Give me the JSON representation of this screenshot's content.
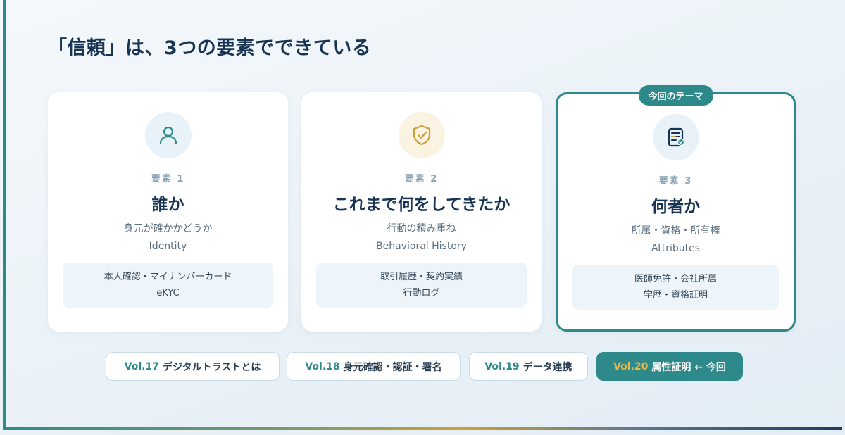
{
  "heading": "「信頼」は、3つの要素でできている",
  "cards": [
    {
      "icon": "person-icon",
      "element_no": "要素 1",
      "title": "誰か",
      "desc_ja": "身元が確かかどうか",
      "desc_en": "Identity",
      "example_line1": "本人確認・マイナンバーカード",
      "example_line2": "eKYC"
    },
    {
      "icon": "shield-check-icon",
      "element_no": "要素 2",
      "title": "これまで何をしてきたか",
      "desc_ja": "行動の積み重ね",
      "desc_en": "Behavioral History",
      "example_line1": "取引履歴・契約実績",
      "example_line2": "行動ログ"
    },
    {
      "icon": "certificate-icon",
      "badge": "今回のテーマ",
      "element_no": "要素 3",
      "title": "何者か",
      "desc_ja": "所属・資格・所有権",
      "desc_en": "Attributes",
      "example_line1": "医師免許・会社所属",
      "example_line2": "学歴・資格証明"
    }
  ],
  "nav": [
    {
      "vol": "Vol.17",
      "label": "デジタルトラストとは"
    },
    {
      "vol": "Vol.18",
      "label": "身元確認・認証・署名"
    },
    {
      "vol": "Vol.19",
      "label": "データ連携"
    },
    {
      "vol": "Vol.20",
      "label": "属性証明 ← 今回"
    }
  ],
  "colors": {
    "accent": "#2e8a8a",
    "gold": "#c9a13a",
    "navy": "#173453"
  }
}
